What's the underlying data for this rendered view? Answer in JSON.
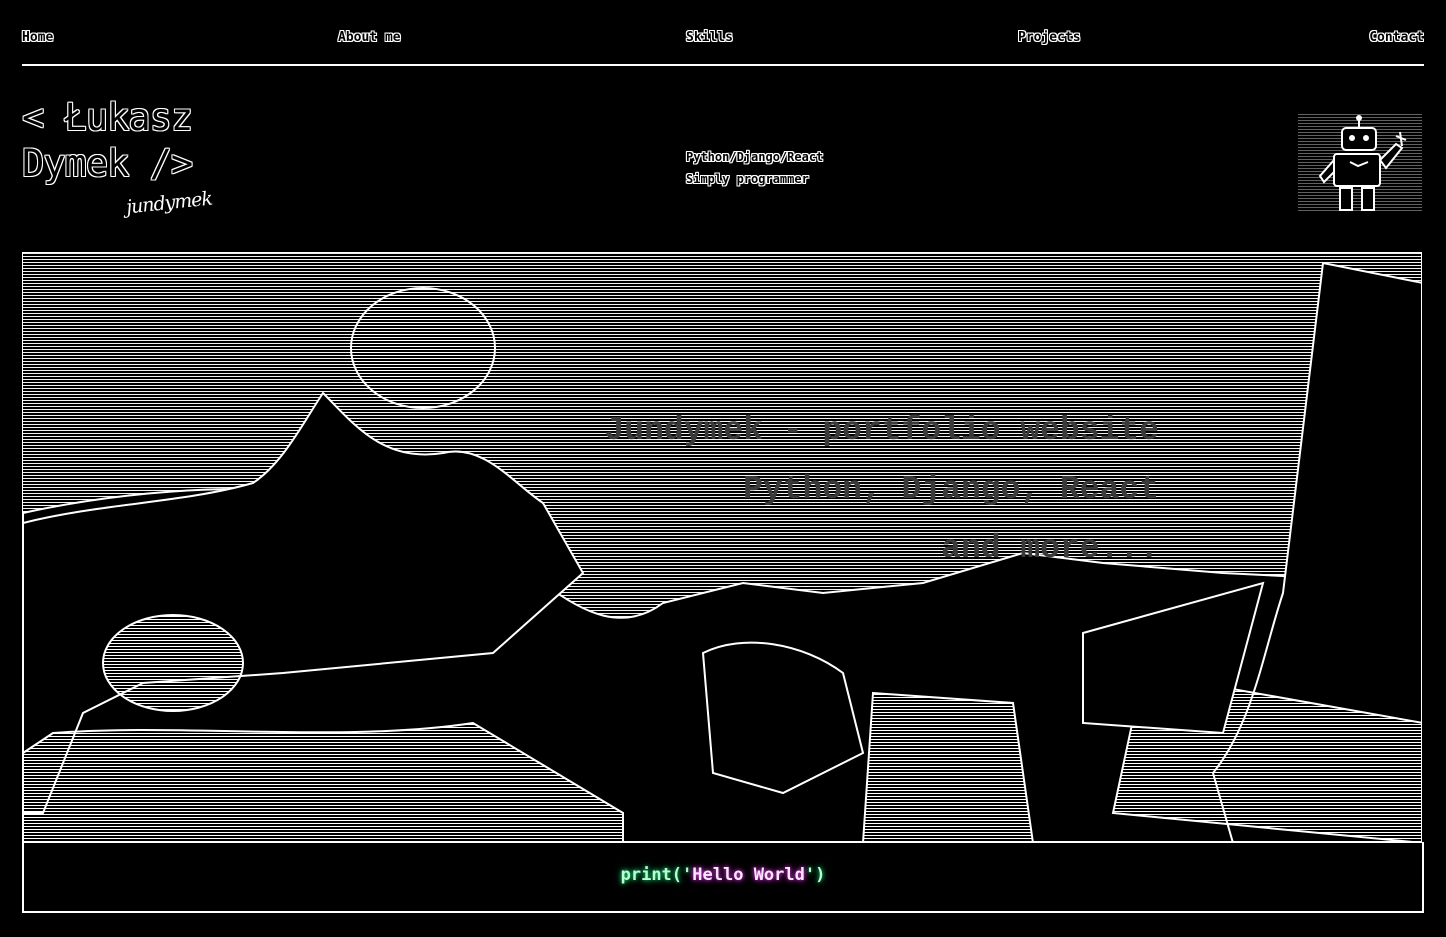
{
  "nav": {
    "items": [
      {
        "label": "Home"
      },
      {
        "label": "About me"
      },
      {
        "label": "Skills"
      },
      {
        "label": "Projects"
      },
      {
        "label": "Contact"
      }
    ]
  },
  "logo": {
    "line1": "< Łukasz",
    "line2": "Dymek />",
    "signature": "jundymek"
  },
  "tagline": {
    "line1": "Python/Django/React",
    "line2": "Simply programmer"
  },
  "hero": {
    "line1": "Jundymek - portfolio website",
    "line2": "Python, Django, React",
    "line3": "and more..."
  },
  "footer": {
    "code_fn": "print(",
    "code_quote_open": "'",
    "code_str": "Hello World",
    "code_quote_close": "'",
    "code_close": ")"
  },
  "icons": {
    "robot": "robot-icon"
  },
  "colors": {
    "background": "#000000",
    "foreground": "#ffffff",
    "code_green": "#1bd67a",
    "code_magenta": "#d23ad8"
  }
}
